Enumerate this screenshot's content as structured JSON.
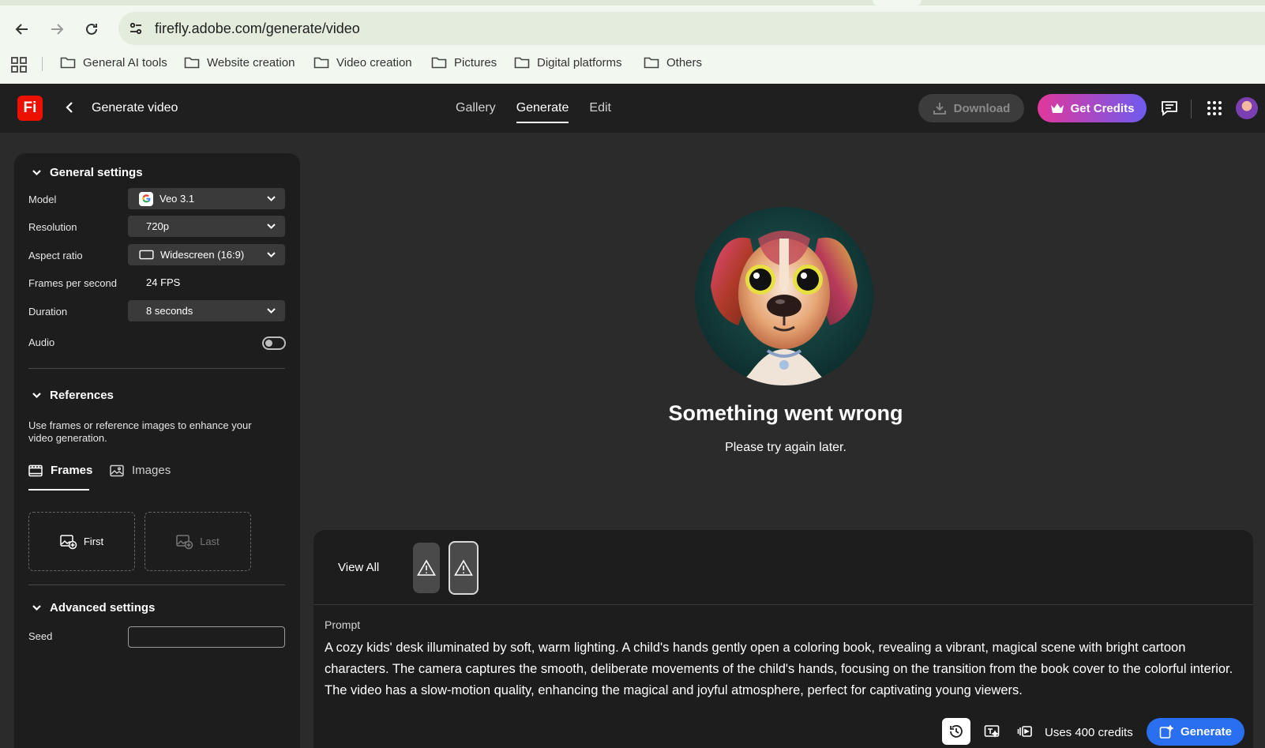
{
  "browser": {
    "url": "firefly.adobe.com/generate/video",
    "bookmarks": [
      "General AI tools",
      "Website creation",
      "Video creation",
      "Pictures",
      "Digital platforms",
      "Others"
    ]
  },
  "header": {
    "logo": "Fi",
    "title": "Generate video",
    "tabs": [
      "Gallery",
      "Generate",
      "Edit"
    ],
    "active_tab": "Generate",
    "download_label": "Download",
    "credits_label": "Get Credits"
  },
  "general": {
    "heading": "General settings",
    "model_label": "Model",
    "model_value": "Veo 3.1",
    "resolution_label": "Resolution",
    "resolution_value": "720p",
    "aspect_label": "Aspect ratio",
    "aspect_value": "Widescreen (16:9)",
    "fps_label": "Frames per second",
    "fps_value": "24 FPS",
    "duration_label": "Duration",
    "duration_value": "8 seconds",
    "audio_label": "Audio",
    "audio_on": false
  },
  "references": {
    "heading": "References",
    "description": "Use frames or reference images to enhance your video generation.",
    "tab_frames": "Frames",
    "tab_images": "Images",
    "first_label": "First",
    "last_label": "Last"
  },
  "advanced": {
    "heading": "Advanced settings",
    "seed_label": "Seed",
    "seed_value": ""
  },
  "main": {
    "error_title": "Something went wrong",
    "error_subtitle": "Please try again later."
  },
  "bottom": {
    "view_all": "View All",
    "prompt_label": "Prompt",
    "prompt_text": "A cozy kids' desk illuminated by soft, warm lighting. A child's hands gently open a coloring book, revealing a vibrant, magical scene with bright cartoon characters. The camera captures the smooth, deliberate movements of the child's hands, focusing on the transition from the book cover to the colorful interior. The video has a slow-motion quality, enhancing the magical and joyful atmosphere, perfect for captivating young viewers.",
    "credits_text": "Uses 400 credits",
    "generate_label": "Generate"
  },
  "colors": {
    "accent_blue": "#2a6ff0",
    "logo_red": "#eb1000",
    "credits_gradient_start": "#e0379b",
    "credits_gradient_end": "#6f5bf0"
  }
}
